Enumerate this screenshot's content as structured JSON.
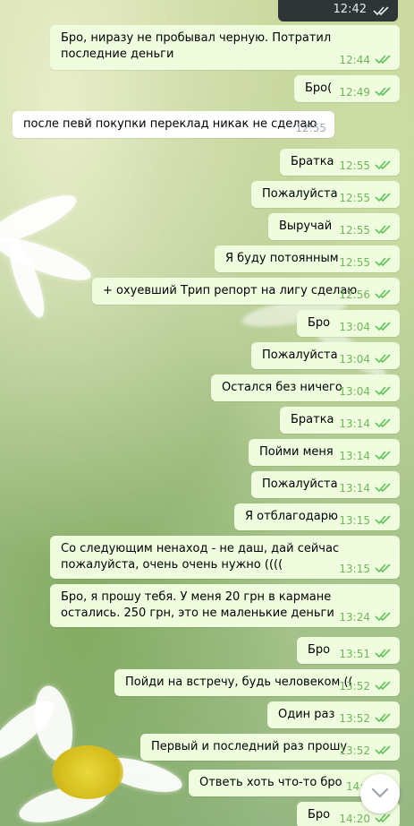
{
  "top_message": {
    "time": "12:42"
  },
  "messages": [
    {
      "text": "Бро, ниразу не пробывал черную. Потратил последние деньги",
      "time": "12:44",
      "dir": "out"
    },
    {
      "text": "Бро(",
      "time": "12:49",
      "dir": "out"
    },
    {
      "text": "после певй покупки переклад никак не сделаю",
      "time": "12:55",
      "dir": "in"
    },
    {
      "text": "Братка",
      "time": "12:55",
      "dir": "out"
    },
    {
      "text": "Пожалуйста",
      "time": "12:55",
      "dir": "out"
    },
    {
      "text": "Выручай",
      "time": "12:55",
      "dir": "out"
    },
    {
      "text": "Я буду потоянным",
      "time": "12:55",
      "dir": "out"
    },
    {
      "text": "+ охуевший Трип репорт на лигу сделаю",
      "time": "12:56",
      "dir": "out"
    },
    {
      "text": "Бро",
      "time": "13:04",
      "dir": "out"
    },
    {
      "text": "Пожалуйста",
      "time": "13:04",
      "dir": "out"
    },
    {
      "text": "Остался без ничего",
      "time": "13:04",
      "dir": "out"
    },
    {
      "text": "Братка",
      "time": "13:14",
      "dir": "out"
    },
    {
      "text": "Пойми меня",
      "time": "13:14",
      "dir": "out"
    },
    {
      "text": "Пожалуйста",
      "time": "13:14",
      "dir": "out"
    },
    {
      "text": "Я отблагодарю",
      "time": "13:15",
      "dir": "out"
    },
    {
      "text": "Со следующим ненаход - не даш, дай сейчас пожалуйста, очень очень нужно ((((",
      "time": "13:15",
      "dir": "out"
    },
    {
      "text": "Бро, я прошу тебя. У меня 20 грн в кармане остались. 250 грн, это не маленькие деньги",
      "time": "13:24",
      "dir": "out"
    },
    {
      "text": "Бро",
      "time": "13:51",
      "dir": "out"
    },
    {
      "text": "Пойди на встречу, будь человеком ((",
      "time": "13:52",
      "dir": "out"
    },
    {
      "text": "Один раз",
      "time": "13:52",
      "dir": "out"
    },
    {
      "text": "Первый и последний раз прошу",
      "time": "13:52",
      "dir": "out"
    },
    {
      "text": "Ответь хоть что-то бро",
      "time": "14:0",
      "dir": "out"
    },
    {
      "text": "Бро",
      "time": "14:20",
      "dir": "out"
    }
  ],
  "colors": {
    "outgoing_bubble": "#effdde",
    "incoming_bubble": "#ffffff",
    "time_outgoing": "#6fb65a",
    "time_incoming": "#a0acb6"
  },
  "icons": {
    "read_receipt": "double-check-icon",
    "scroll_down": "chevron-down-icon"
  }
}
